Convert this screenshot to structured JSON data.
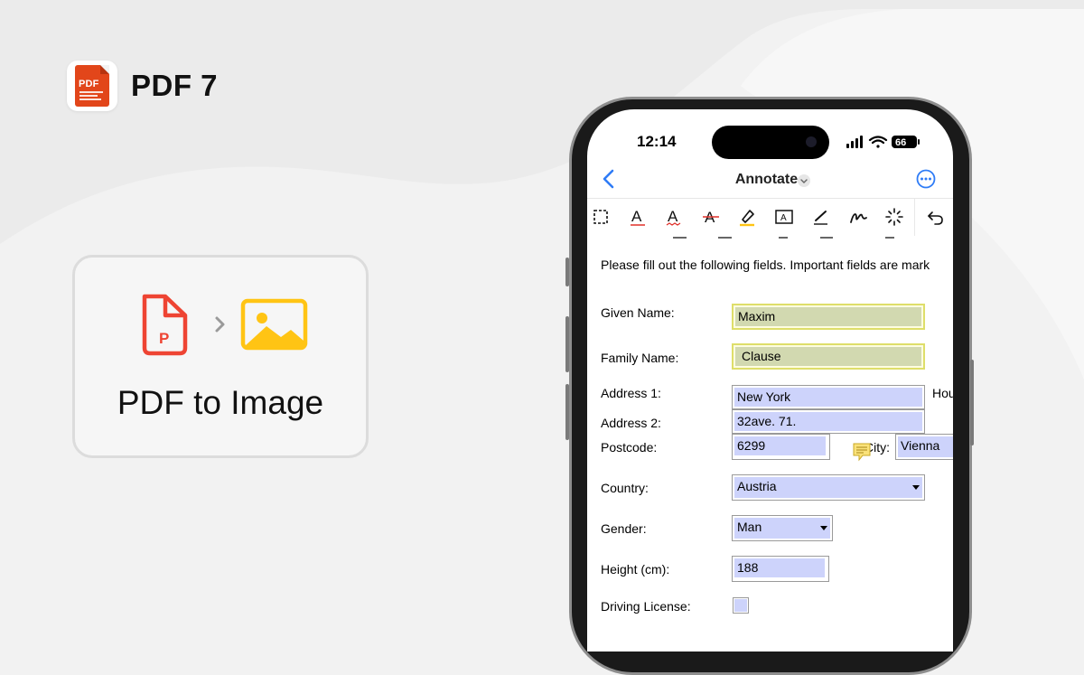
{
  "colors": {
    "accent": "#e2461a",
    "required_field": "#d2d9b0",
    "optional_field": "#cdd3fb",
    "link_blue": "#2f7cf6"
  },
  "brand": {
    "name": "PDF 7",
    "logo_text": "PDF"
  },
  "feature": {
    "title": "PDF to Image",
    "source_icon": "pdf-file-icon",
    "arrow_icon": "chevron-right-icon",
    "target_icon": "image-icon"
  },
  "status_bar": {
    "time": "12:14",
    "battery": "66"
  },
  "nav": {
    "title": "Annotate"
  },
  "toolbar": {
    "tools": [
      "select-rect-icon",
      "text-underline-icon",
      "text-squiggly-icon",
      "text-strikeout-icon",
      "highlighter-icon",
      "text-box-icon",
      "pen-icon",
      "freehand-icon",
      "magic-wand-icon",
      "undo-icon"
    ]
  },
  "form": {
    "intro": "Please fill out the following fields. Important fields are mark",
    "given_name_label": "Given Name:",
    "given_name_value": "Maxim",
    "family_name_label": "Family Name:",
    "family_name_value": "Clause",
    "address1_label": "Address 1:",
    "address1_value": "New York",
    "house_label": "Hou",
    "address2_label": "Address 2:",
    "address2_value": "32ave. 71.",
    "postcode_label": "Postcode:",
    "postcode_value": "6299",
    "city_label": "City:",
    "city_value": "Vienna",
    "country_label": "Country:",
    "country_value": "Austria",
    "gender_label": "Gender:",
    "gender_value": "Man",
    "height_label": "Height (cm):",
    "height_value": "188",
    "driving_label": "Driving License:"
  }
}
